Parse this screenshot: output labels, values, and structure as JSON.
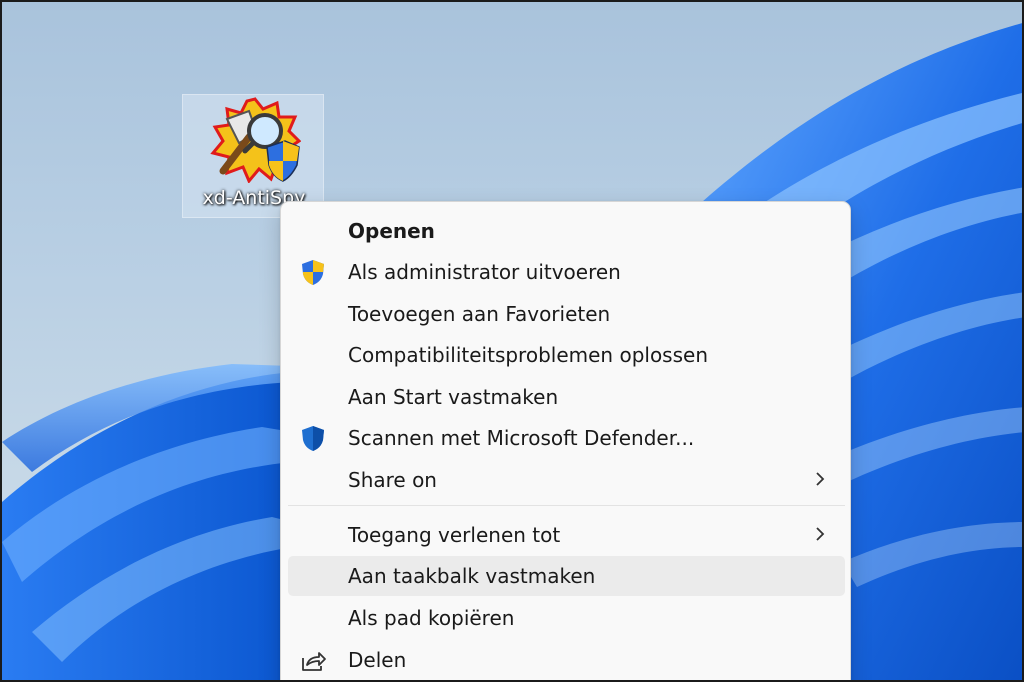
{
  "desktop": {
    "icon_label": "xd-AntiSpy"
  },
  "menu": {
    "items": [
      {
        "label": "Openen"
      },
      {
        "label": "Als administrator uitvoeren"
      },
      {
        "label": "Toevoegen aan Favorieten"
      },
      {
        "label": "Compatibiliteitsproblemen oplossen"
      },
      {
        "label": "Aan Start vastmaken"
      },
      {
        "label": "Scannen met Microsoft Defender..."
      },
      {
        "label": "Share on"
      },
      {
        "label": "Toegang verlenen tot"
      },
      {
        "label": "Aan taakbalk vastmaken"
      },
      {
        "label": "Als pad kopiëren"
      },
      {
        "label": "Delen"
      }
    ]
  },
  "colors": {
    "wallpaper_sky": "#b7cee3",
    "wallpaper_bloom": "#1f6ee8",
    "menu_background": "#f9f9f9",
    "hover_background": "#ebebeb",
    "uac_blue": "#2d6fe0",
    "uac_yellow": "#f7c21a",
    "defender_blue": "#1f6fd0"
  },
  "icons": {
    "app": "antispy-app-icon",
    "uac": "uac-shield-icon",
    "defender": "defender-shield-icon",
    "share": "share-icon",
    "submenu": "chevron-right-icon"
  }
}
